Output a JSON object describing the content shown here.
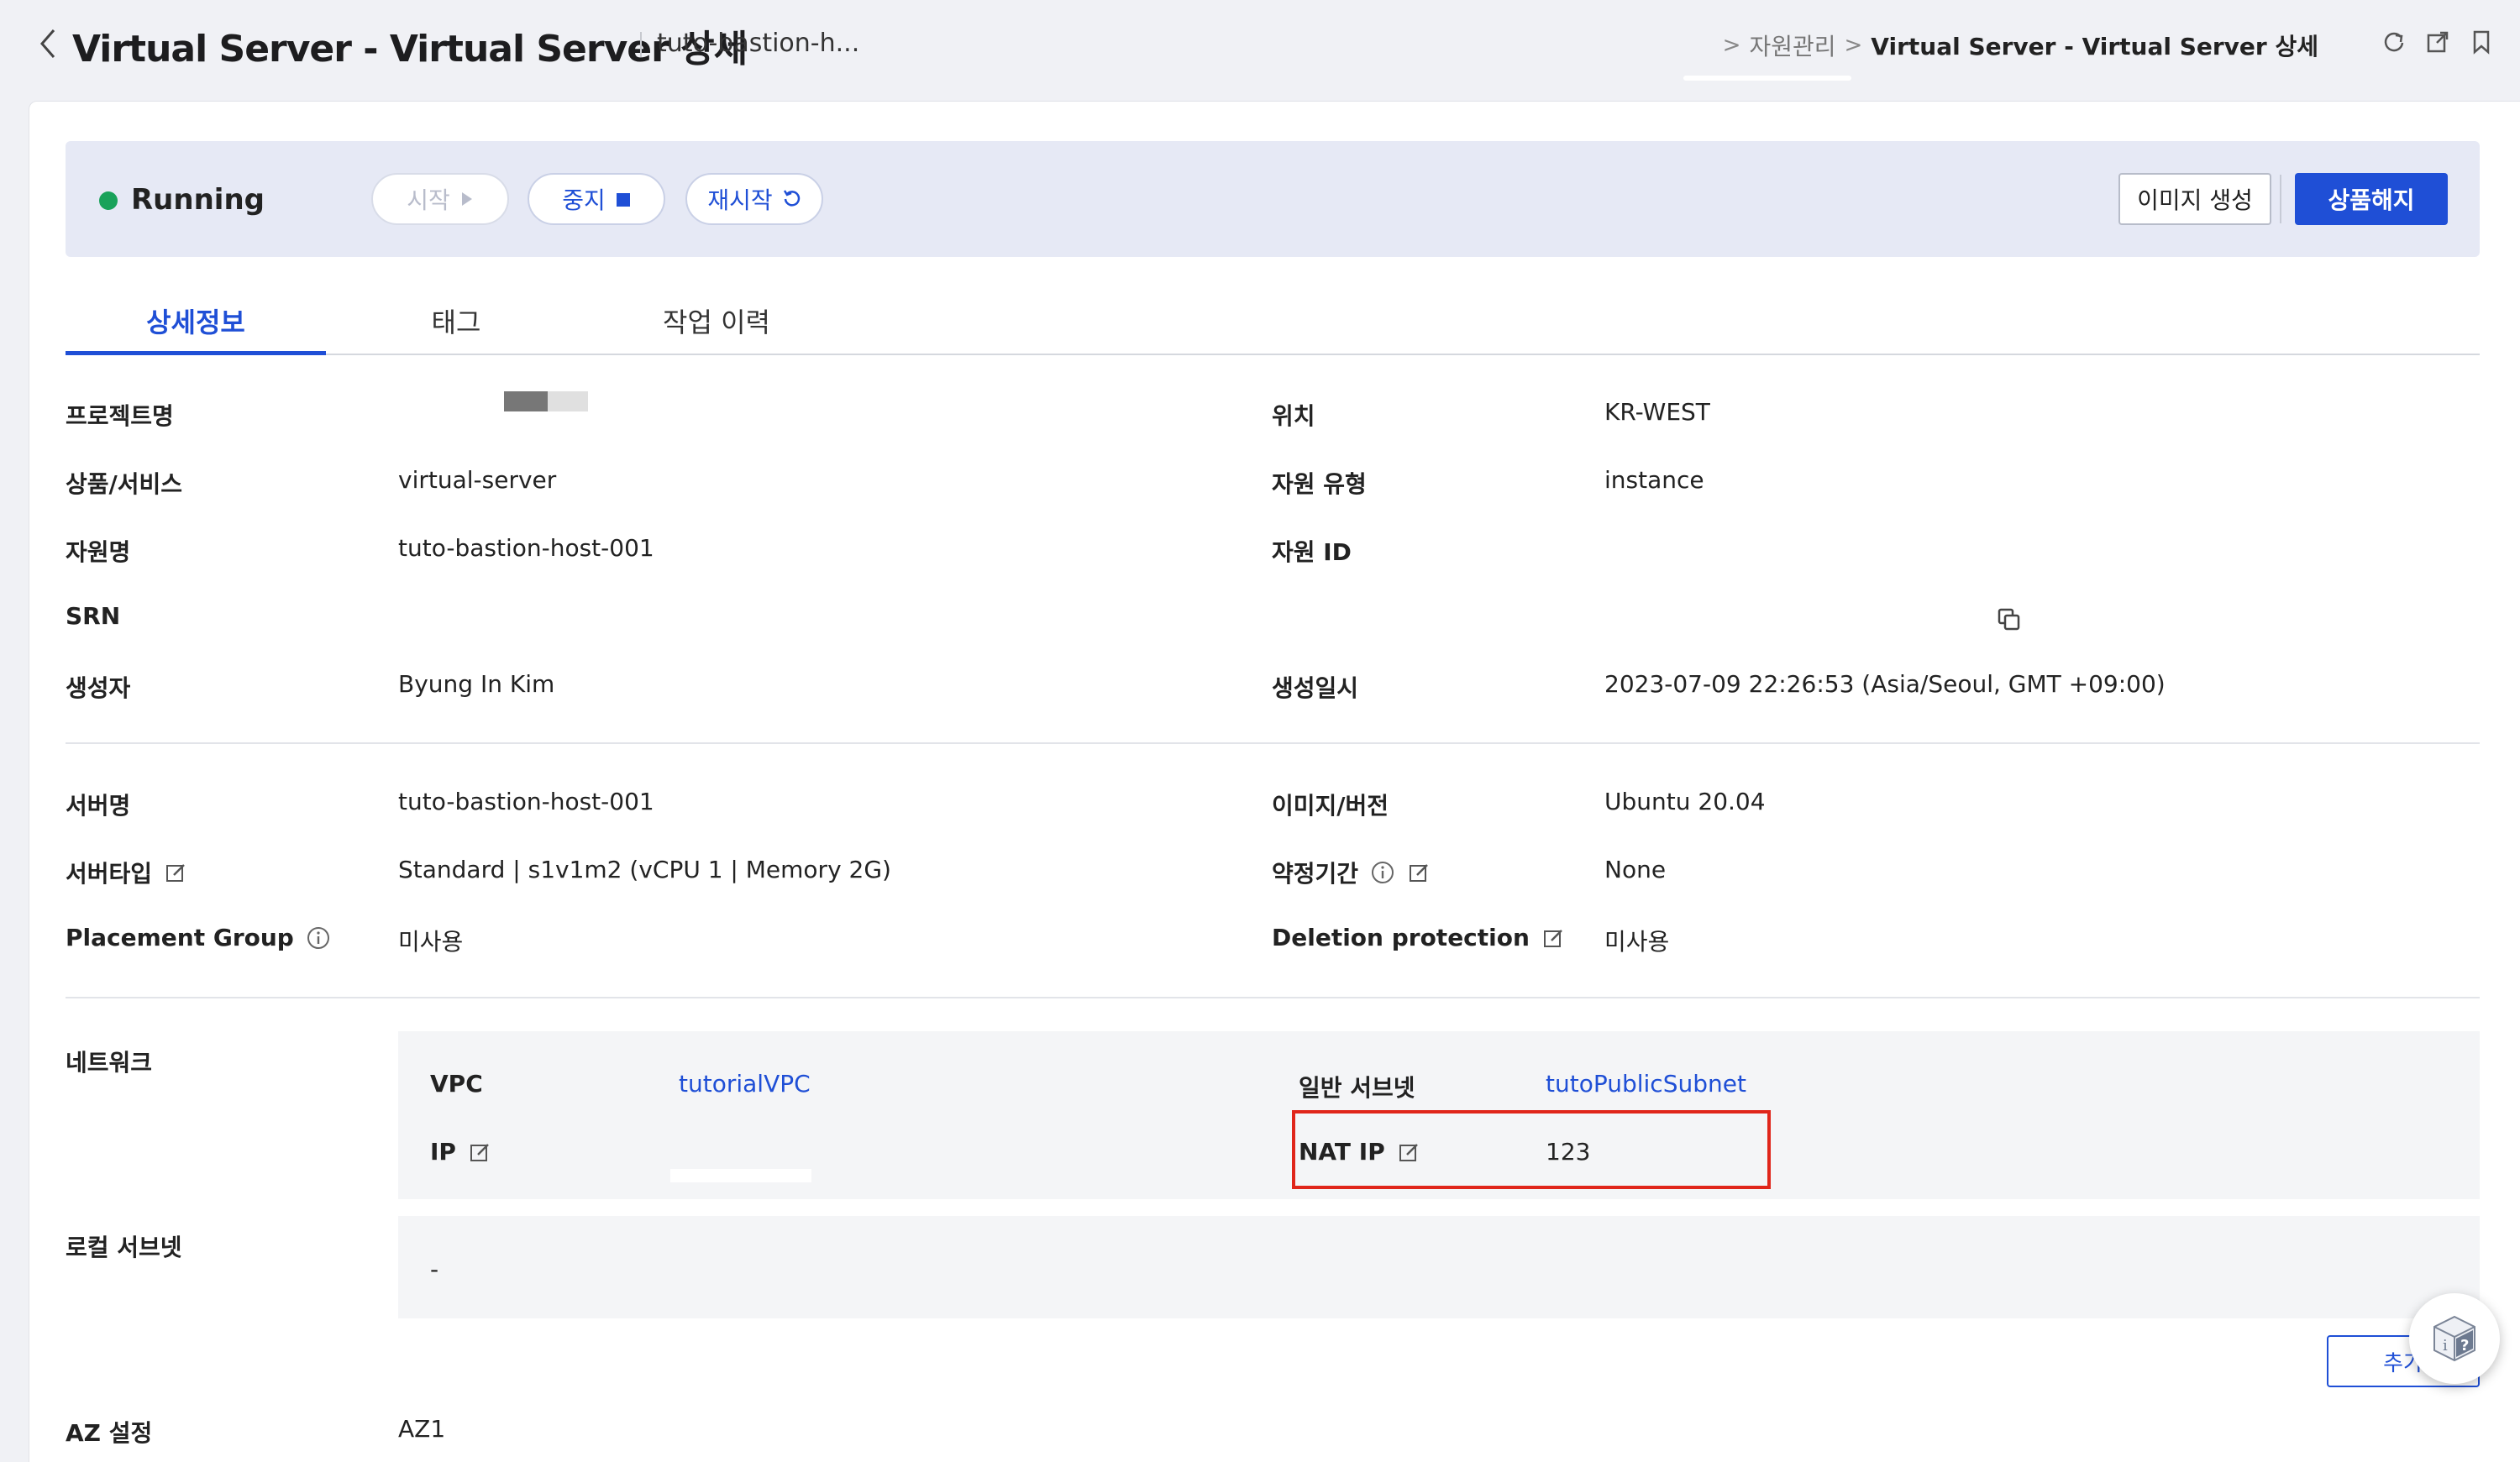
{
  "header": {
    "title": "Virtual Server - Virtual Server 상세",
    "subtitle": "tuto-bastion-h...",
    "breadcrumb": [
      "자원관리",
      "Virtual Server - Virtual Server 상세"
    ]
  },
  "action_bar": {
    "status": "Running",
    "status_color": "#19a25a",
    "start_label": "시작",
    "stop_label": "중지",
    "restart_label": "재시작",
    "create_image_label": "이미지 생성",
    "terminate_label": "상품해지"
  },
  "tabs": [
    "상세정보",
    "태그",
    "작업 이력"
  ],
  "active_tab": "상세정보",
  "details": {
    "project_label": "프로젝트명",
    "location_label": "위치",
    "location_value": "KR-WEST",
    "product_label": "상품/서비스",
    "product_value": "virtual-server",
    "resource_type_label": "자원 유형",
    "resource_type_value": "instance",
    "resource_name_label": "자원명",
    "resource_name_value": "tuto-bastion-host-001",
    "resource_id_label": "자원 ID",
    "srn_label": "SRN",
    "creator_label": "생성자",
    "creator_value": "Byung In Kim",
    "created_at_label": "생성일시",
    "created_at_value": "2023-07-09 22:26:53 (Asia/Seoul, GMT +09:00)"
  },
  "server": {
    "server_name_label": "서버명",
    "server_name_value": "tuto-bastion-host-001",
    "image_label": "이미지/버전",
    "image_value": "Ubuntu 20.04",
    "server_type_label": "서버타입",
    "server_type_value": "Standard | s1v1m2 (vCPU 1 | Memory 2G)",
    "contract_label": "약정기간",
    "contract_value": "None",
    "placement_label": "Placement Group",
    "placement_value": "미사용",
    "deletion_label": "Deletion protection",
    "deletion_value": "미사용"
  },
  "network": {
    "section_label": "네트워크",
    "vpc_label": "VPC",
    "vpc_value": "tutorialVPC",
    "subnet_label": "일반 서브넷",
    "subnet_value": "tutoPublicSubnet",
    "ip_label": "IP",
    "nat_ip_label": "NAT IP",
    "nat_ip_value": "123",
    "local_subnet_label": "로컬 서브넷",
    "local_subnet_value": "-",
    "add_label": "추가"
  },
  "az": {
    "label": "AZ 설정",
    "value": "AZ1"
  },
  "colors": {
    "accent": "#1f4fd6",
    "highlight": "#e0261b"
  }
}
